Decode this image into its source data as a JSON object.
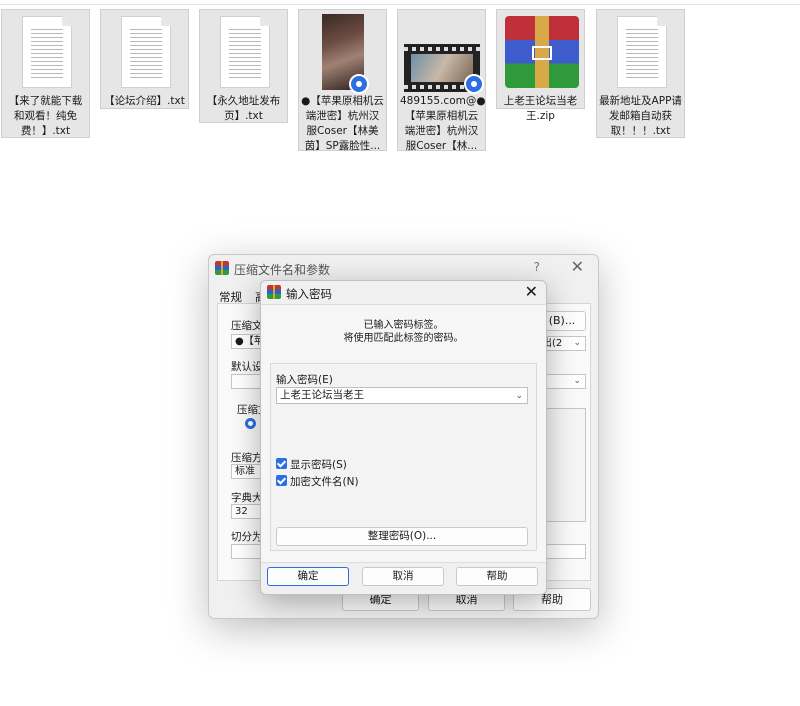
{
  "files": [
    {
      "name": "【来了就能下载和观看！纯免费！】.txt",
      "kind": "txt"
    },
    {
      "name": "【论坛介绍】.txt",
      "kind": "txt"
    },
    {
      "name": "【永久地址发布页】.txt",
      "kind": "txt"
    },
    {
      "name": "●【苹果原相机云端泄密】杭州汉服Coser【林美茵】SP露脸性...",
      "kind": "image"
    },
    {
      "name": "489155.com@●【苹果原相机云端泄密】杭州汉服Coser【林...",
      "kind": "video"
    },
    {
      "name": "上老王论坛当老王.zip",
      "kind": "zip"
    },
    {
      "name": "最新地址及APP请发邮箱自动获取！！！.txt",
      "kind": "txt"
    }
  ],
  "back_dialog": {
    "title": "压缩文件名和参数",
    "help": "?",
    "close": "✕",
    "tab_general": "常规",
    "tab_advanced": "高",
    "archive_name_label": "压缩文件",
    "archive_name_value": "●【苹",
    "browse_button": "(B)...",
    "update_combo": "出(2",
    "default_config_label": "默认设",
    "format_label": "压缩文",
    "method_label": "压缩方",
    "method_value": "标准",
    "dict_label": "字典大小",
    "dict_value": "32",
    "split_label": "切分为分",
    "ok": "确定",
    "cancel": "取消",
    "help_button": "帮助"
  },
  "front_dialog": {
    "title": "输入密码",
    "close": "✕",
    "message_line1": "已输入密码标签。",
    "message_line2": "将使用匹配此标签的密码。",
    "password_label": "输入密码(E)",
    "password_value": "上老王论坛当老王",
    "show_password": "显示密码(S)",
    "encrypt_filenames": "加密文件名(N)",
    "organize_button": "整理密码(O)...",
    "ok": "确定",
    "cancel": "取消",
    "help_button": "帮助"
  }
}
